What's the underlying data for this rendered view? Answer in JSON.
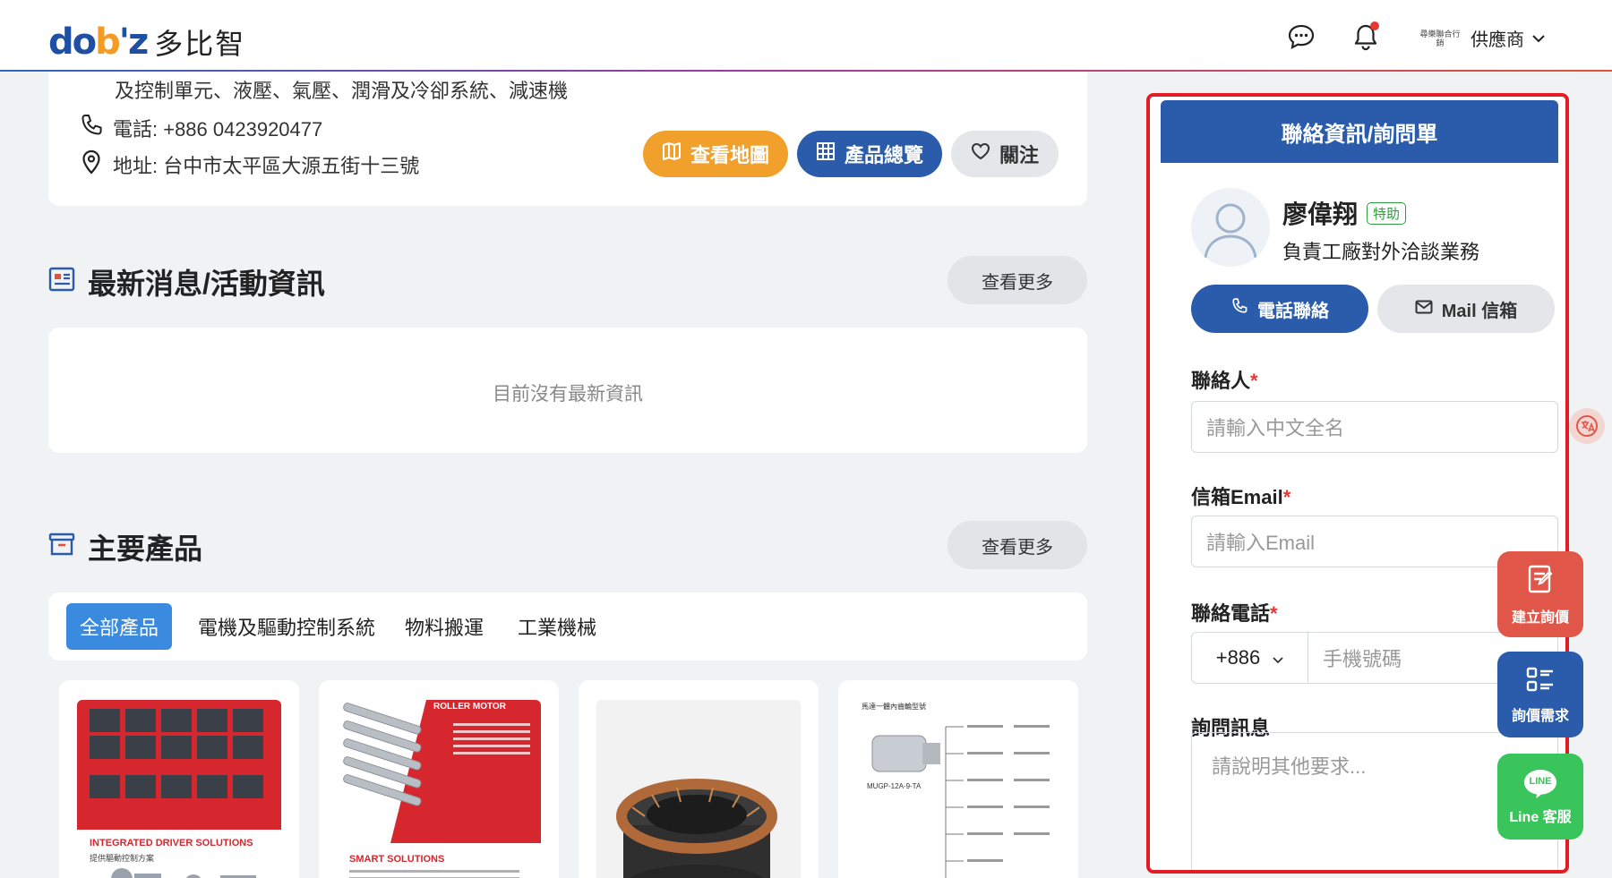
{
  "header": {
    "logo_mark_a": "do",
    "logo_mark_b": "b",
    "logo_mark_c": "'z",
    "logo_text": "多比智",
    "supplier_logo_text": "尋樂聯合行銷",
    "supplier_label": "供應商",
    "icons": [
      "chat-icon",
      "bell-icon",
      "chevron-down-icon"
    ]
  },
  "company": {
    "business_scope_tail": "及控制單元、液壓、氣壓、潤滑及冷卻系統、減速機",
    "phone": "電話: +886 0423920477",
    "address": "地址: 台中市太平區大源五街十三號",
    "btn_map": "查看地圖",
    "btn_products": "產品總覽",
    "btn_follow": "關注"
  },
  "news": {
    "title": "最新消息/活動資訊",
    "more": "查看更多",
    "empty": "目前沒有最新資訊"
  },
  "products": {
    "title": "主要產品",
    "more": "查看更多",
    "tabs": [
      {
        "label": "全部產品",
        "active": true
      },
      {
        "label": "電機及驅動控制系統",
        "active": false
      },
      {
        "label": "物料搬運",
        "active": false
      },
      {
        "label": "工業機械",
        "active": false
      }
    ],
    "items": [
      {
        "caption": "INTEGRATED DRIVER SOLUTIONS",
        "subcaption": "提供驅動控制方案"
      },
      {
        "caption": "ROLLER MOTOR",
        "subcaption": "SMART SOLUTIONS"
      },
      {
        "caption": "",
        "subcaption": ""
      },
      {
        "caption": "馬達一體內齒輪型號",
        "subcaption": "MUGP-12A-9-TA"
      }
    ]
  },
  "contact_panel": {
    "title": "聯絡資訊/詢問單",
    "person_name": "廖偉翔",
    "person_badge": "特助",
    "person_role": "負責工廠對外洽談業務",
    "btn_call": "電話聯絡",
    "btn_mail": "Mail 信箱",
    "fields": {
      "contact_label": "聯絡人",
      "contact_placeholder": "請輸入中文全名",
      "email_label": "信箱Email",
      "email_placeholder": "請輸入Email",
      "phone_label": "聯絡電話",
      "phone_code": "+886",
      "phone_placeholder": "手機號碼",
      "message_label": "詢問訊息",
      "message_placeholder": "請說明其他要求..."
    },
    "required_mark": "*"
  },
  "floating": {
    "create_inquiry": "建立詢價",
    "quote_request": "詢價需求",
    "line_service": "Line 客服",
    "line_logo": "LINE"
  },
  "colors": {
    "primary": "#2a5cab",
    "accent_orange": "#f0a02b",
    "highlight_red": "#e31b23",
    "tab_active": "#3a8be0",
    "line_green": "#3ac45c"
  }
}
